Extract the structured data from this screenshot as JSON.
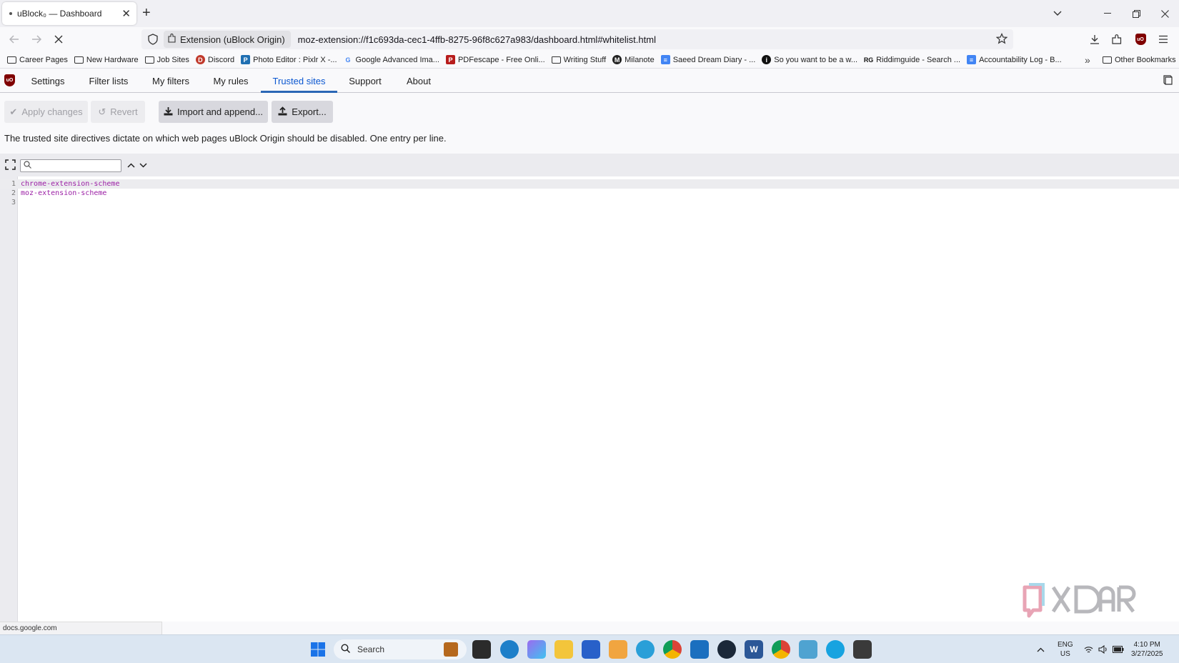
{
  "browser": {
    "tab_title": "uBlock₀ — Dashboard",
    "new_tab_symbol": "+",
    "identity_label": "Extension (uBlock Origin)",
    "url": "moz-extension://f1c693da-cec1-4ffb-8275-96f8c627a983/dashboard.html#whitelist.html",
    "extension_badge": "uO"
  },
  "bookmarks": [
    {
      "label": "Career Pages",
      "icon": "folder-icon"
    },
    {
      "label": "New Hardware",
      "icon": "folder-icon"
    },
    {
      "label": "Job Sites",
      "icon": "folder-icon"
    },
    {
      "label": "Discord",
      "icon": "discord-icon"
    },
    {
      "label": "Photo Editor : Pixlr X -...",
      "icon": "pixlr-icon"
    },
    {
      "label": "Google Advanced Ima...",
      "icon": "google-icon"
    },
    {
      "label": "PDFescape - Free Onli...",
      "icon": "pdfescape-icon"
    },
    {
      "label": "Writing Stuff",
      "icon": "folder-icon"
    },
    {
      "label": "Milanote",
      "icon": "milanote-icon"
    },
    {
      "label": "Saeed Dream Diary - ...",
      "icon": "docs-icon"
    },
    {
      "label": "So you want to be a w...",
      "icon": "site-icon"
    },
    {
      "label": "Riddimguide - Search ...",
      "icon": "rg-icon"
    },
    {
      "label": "Accountability Log - B...",
      "icon": "docs-icon"
    }
  ],
  "bookmarks_other": "Other Bookmarks",
  "dashboard": {
    "logo_text": "uO",
    "tabs": [
      "Settings",
      "Filter lists",
      "My filters",
      "My rules",
      "Trusted sites",
      "Support",
      "About"
    ],
    "active_tab": "Trusted sites"
  },
  "toolbar": {
    "apply_label": "Apply changes",
    "revert_label": "Revert",
    "import_label": "Import and append...",
    "export_label": "Export..."
  },
  "description": "The trusted site directives dictate on which web pages uBlock Origin should be disabled. One entry per line.",
  "editor": {
    "search_value": "",
    "lines": [
      {
        "number": "1",
        "text": "chrome-extension-scheme"
      },
      {
        "number": "2",
        "text": "moz-extension-scheme"
      },
      {
        "number": "3",
        "text": ""
      }
    ]
  },
  "status_link": "docs.google.com",
  "taskbar": {
    "search_placeholder": "Search",
    "language": "ENG",
    "region": "US",
    "time": "4:10 PM",
    "date": "3/27/2025"
  },
  "colors": {
    "active_tab": "#0b57d0",
    "editor_text": "#9b1fa5",
    "ublock_red": "#800000"
  }
}
